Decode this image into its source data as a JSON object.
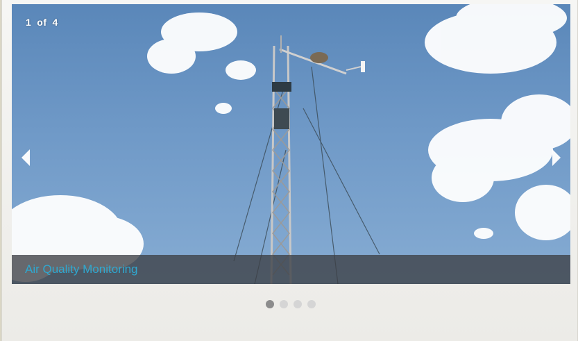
{
  "slider": {
    "counter": {
      "current": "1",
      "separator": "of",
      "total": "4"
    },
    "caption": "Air Quality Monitoring",
    "image_subject": "meteorological tower against cloudy blue sky",
    "pager": {
      "count": 4,
      "active_index": 0
    },
    "icons": {
      "prev": "chevron-left-icon",
      "next": "chevron-right-icon"
    },
    "colors": {
      "caption_text": "#2fa8d0",
      "caption_bar": "#3c3f44",
      "dot_active": "#8c8c8c",
      "dot_inactive": "#d5d5d5"
    }
  }
}
